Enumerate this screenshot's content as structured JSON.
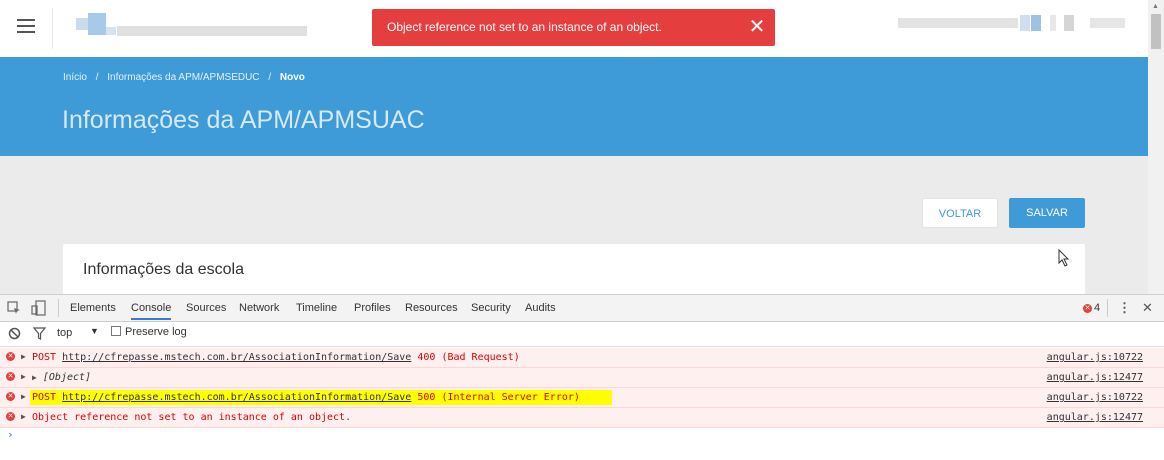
{
  "toast": {
    "message": "Object reference not set to an instance of an object.",
    "close": "✕"
  },
  "breadcrumb": [
    "Início",
    "/",
    "Informações da APM/APMSEDUC",
    "/",
    "Novo"
  ],
  "page": {
    "title": "Informações da APM/APMSUAC"
  },
  "buttons": {
    "back": "VOLTAR",
    "save": "SALVAR"
  },
  "card": {
    "title": "Informações da escola"
  },
  "devtools": {
    "tabs": [
      "Elements",
      "Console",
      "Sources",
      "Network",
      "Timeline",
      "Profiles",
      "Resources",
      "Security",
      "Audits"
    ],
    "active_tab": "Console",
    "error_count": "4",
    "filter": {
      "context": "top",
      "preserve_log": "Preserve log"
    },
    "logs": [
      {
        "method": "POST",
        "url": "http://cfrepasse.mstech.com.br/AssociationInformation/Save",
        "status": "400 (Bad Request)",
        "source": "angular.js:10722"
      },
      {
        "object": "[Object]",
        "source": "angular.js:12477"
      },
      {
        "method": "POST",
        "url": "http://cfrepasse.mstech.com.br/AssociationInformation/Save",
        "status": "500 (Internal Server Error)",
        "source": "angular.js:10722"
      },
      {
        "message": "Object reference not set to an instance of an object.",
        "source": "angular.js:12477"
      }
    ],
    "prompt": "›"
  }
}
